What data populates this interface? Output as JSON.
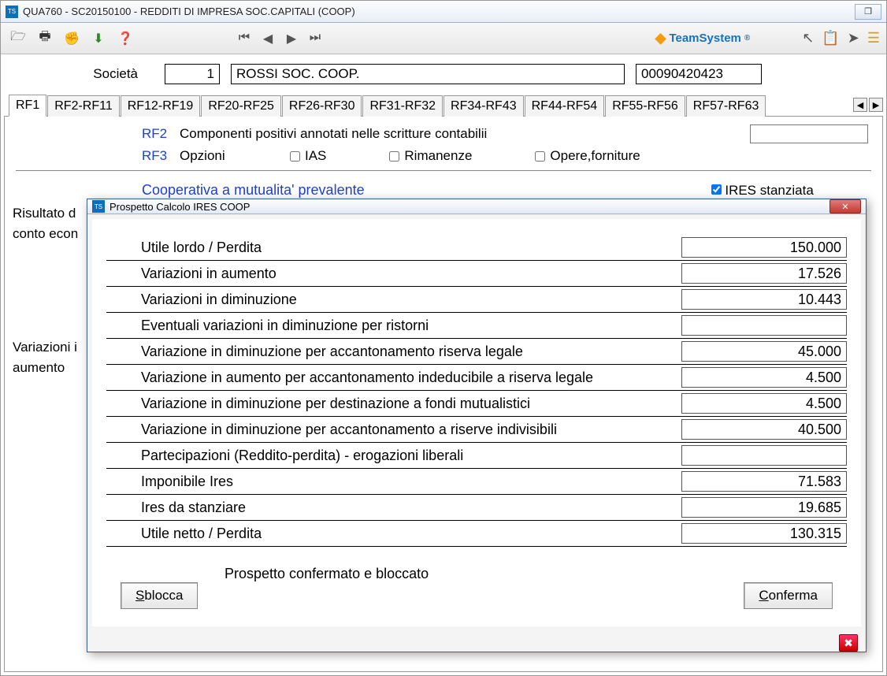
{
  "window": {
    "title": "QUA760  -  SC20150100 -  REDDITI DI IMPRESA SOC.CAPITALI (COOP)"
  },
  "brand": "TeamSystem",
  "header": {
    "societa_label": "Società",
    "societa_num": "1",
    "societa_name": "ROSSI SOC. COOP.",
    "code": "00090420423"
  },
  "tabs": [
    "RF1",
    "RF2-RF11",
    "RF12-RF19",
    "RF20-RF25",
    "RF26-RF30",
    "RF31-RF32",
    "RF34-RF43",
    "RF44-RF54",
    "RF55-RF56",
    "RF57-RF63"
  ],
  "form": {
    "rf2": "RF2",
    "rf2_text": "Componenti positivi annotati nelle scritture contabilii",
    "rf3": "RF3",
    "rf3_text": "Opzioni",
    "opt_ias": "IAS",
    "opt_rim": "Rimanenze",
    "opt_opere": "Opere,forniture",
    "coop_header": "Cooperativa a mutualita' prevalente",
    "ires_cb": "IRES stanziata",
    "side1a": "Risultato d",
    "side1b": "conto econ",
    "side2a": "Variazioni i",
    "side2b": "aumento"
  },
  "modal": {
    "title": "Prospetto Calcolo IRES COOP",
    "rows": [
      {
        "label": "Utile lordo / Perdita",
        "value": "150.000"
      },
      {
        "label": "Variazioni in aumento",
        "value": "17.526"
      },
      {
        "label": "Variazioni in diminuzione",
        "value": "10.443"
      },
      {
        "label": "Eventuali variazioni in diminuzione per ristorni",
        "value": ""
      },
      {
        "label": "Variazione in diminuzione per accantonamento riserva legale",
        "value": "45.000"
      },
      {
        "label": "Variazione in aumento per accantonamento indeducibile a riserva legale",
        "value": "4.500"
      },
      {
        "label": "Variazione in diminuzione per destinazione a fondi mutualistici",
        "value": "4.500"
      },
      {
        "label": "Variazione in diminuzione per accantonamento a riserve indivisibili",
        "value": "40.500"
      },
      {
        "label": "Partecipazioni (Reddito-perdita) - erogazioni liberali",
        "value": ""
      },
      {
        "label": "Imponibile Ires",
        "value": "71.583"
      },
      {
        "label": "Ires da stanziare",
        "value": "19.685"
      },
      {
        "label": "Utile netto / Perdita",
        "value": "130.315"
      }
    ],
    "status": "Prospetto confermato e bloccato",
    "btn_sblocca": "Sblocca",
    "btn_conferma": "Conferma"
  }
}
